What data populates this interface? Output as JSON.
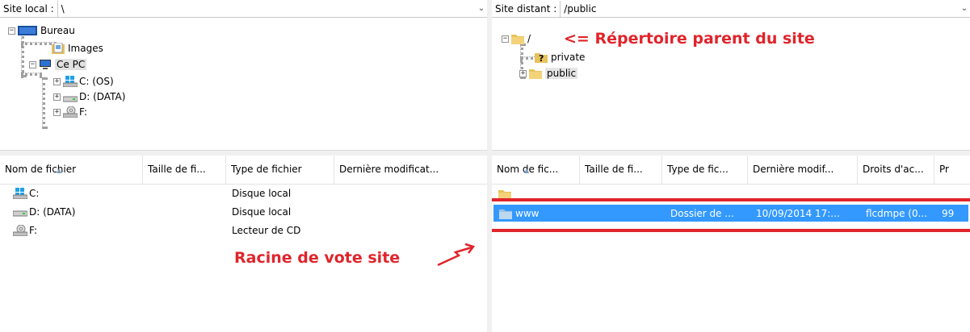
{
  "local": {
    "site_label": "Site local :",
    "path": "\\",
    "tree": [
      "Bureau",
      "Images",
      "Ce PC",
      "C: (OS)",
      "D: (DATA)",
      "F:"
    ],
    "columns": [
      "Nom de fichier",
      "Taille de fi...",
      "Type de fichier",
      "Dernière modificat..."
    ],
    "rows": [
      {
        "name": "C:",
        "type": "Disque local"
      },
      {
        "name": "D: (DATA)",
        "type": "Disque local"
      },
      {
        "name": "F:",
        "type": "Lecteur de CD"
      }
    ]
  },
  "remote": {
    "site_label": "Site distant :",
    "path": "/public",
    "tree": [
      "/",
      "private",
      "public"
    ],
    "columns": [
      "Nom de fic...",
      "Taille de fi...",
      "Type de fic...",
      "Dernière modif...",
      "Droits d'ac...",
      "Pr"
    ],
    "rows": [
      {
        "name": "www",
        "type": "Dossier de ...",
        "modified": "10/09/2014 17:...",
        "rights": "flcdmpe (0...",
        "owner": "99"
      }
    ]
  },
  "annotations": {
    "parent_dir": "<= Répertoire parent du site",
    "site_root": "Racine de vote site"
  },
  "colors": {
    "selection": "#3399ff",
    "annotation": "#e0242b",
    "splitter": "#f0f0f0"
  }
}
